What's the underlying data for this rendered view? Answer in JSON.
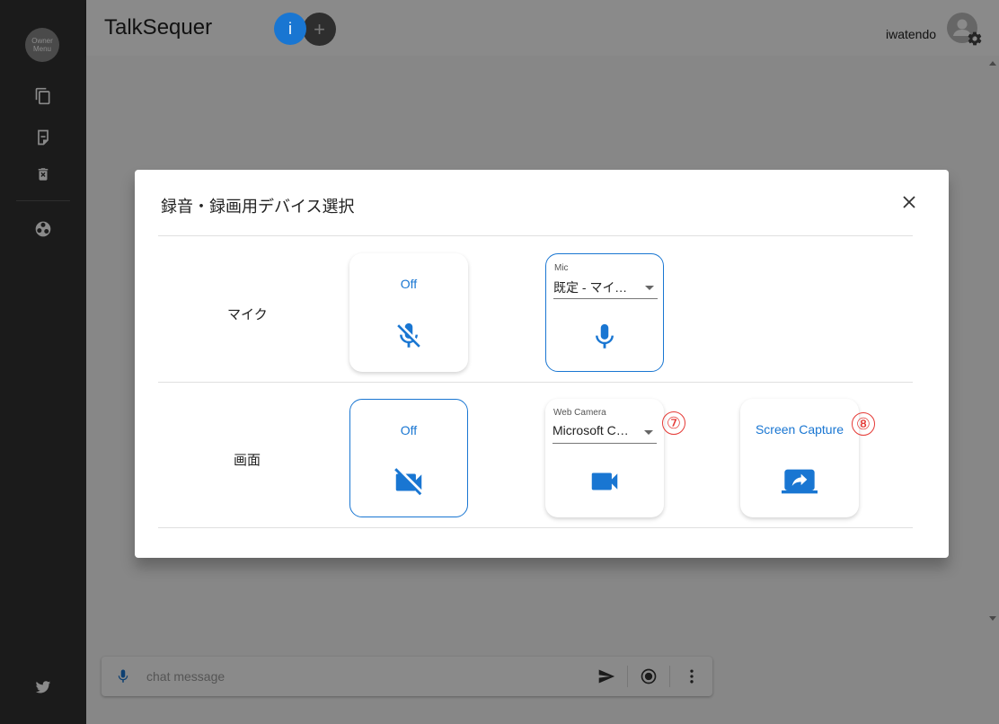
{
  "sidebar": {
    "owner_menu": "Owner\nMenu",
    "icons": [
      "copy-icon",
      "csv-export-icon",
      "delete-icon",
      "obs-icon",
      "twitter-icon"
    ]
  },
  "header": {
    "title": "TalkSequer",
    "info_label": "i",
    "add_label": "+",
    "username": "iwatendo"
  },
  "chat": {
    "placeholder": "chat message"
  },
  "dialog": {
    "title": "録音・録画用デバイス選択",
    "rows": [
      {
        "label": "マイク",
        "off_label": "Off",
        "device_caption": "Mic",
        "device_value": "既定 - マイク..."
      },
      {
        "label": "画面",
        "off_label": "Off",
        "device_caption": "Web Camera",
        "device_value": "Microsoft Camera",
        "screen_label": "Screen Capture"
      }
    ],
    "annotations": [
      "⑦",
      "⑧"
    ]
  },
  "colors": {
    "accent": "#1976d2",
    "sidebar": "#333333",
    "annotation": "#e53935"
  }
}
